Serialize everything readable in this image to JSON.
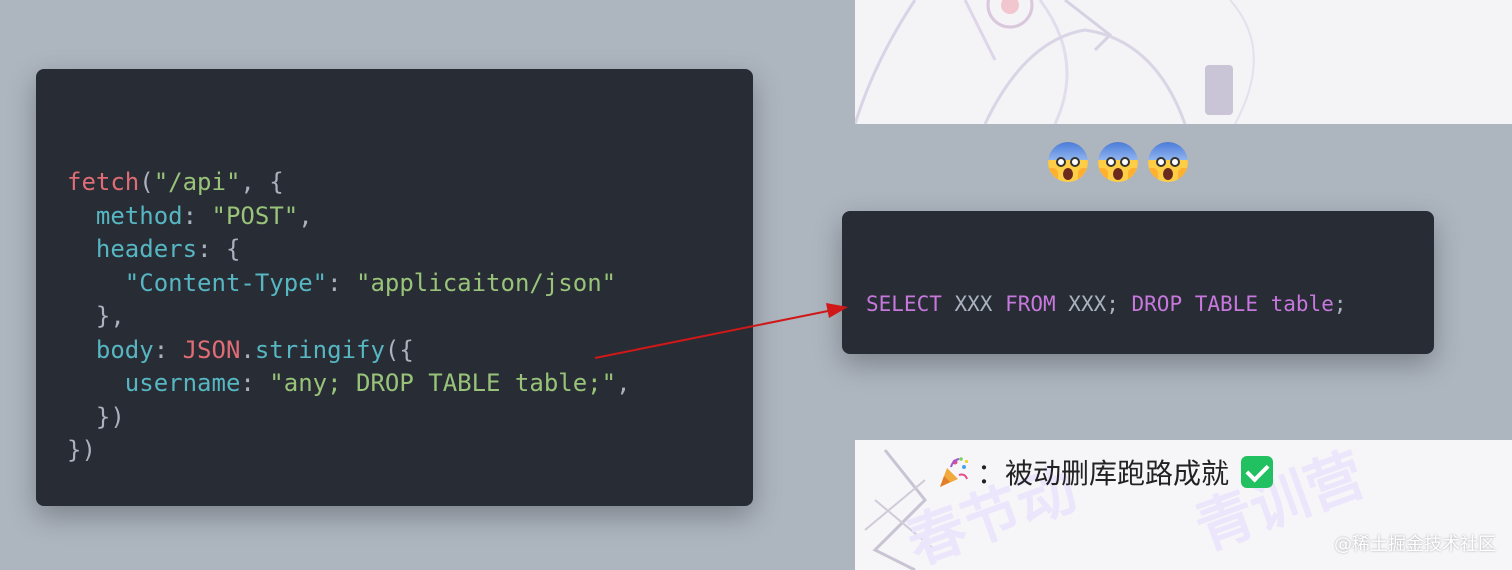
{
  "code_window": {
    "lines": {
      "l1": {
        "fn": "fetch",
        "p1": "(",
        "str": "\"/api\"",
        "p2": ", {"
      },
      "l2": {
        "indent": "  ",
        "key": "method",
        "p1": ": ",
        "str": "\"POST\"",
        "p2": ","
      },
      "l3": {
        "indent": "  ",
        "key": "headers",
        "p1": ": {"
      },
      "l4": {
        "indent": "    ",
        "str1": "\"Content-Type\"",
        "p1": ": ",
        "str2": "\"applicaiton/json\""
      },
      "l5": {
        "text": "  },"
      },
      "l6": {
        "indent": "  ",
        "key": "body",
        "p1": ": ",
        "obj": "JSON",
        "p2": ".",
        "method": "stringify",
        "p3": "({"
      },
      "l7": {
        "indent": "    ",
        "key": "username",
        "p1": ": ",
        "str": "\"any; DROP TABLE table;\"",
        "p2": ","
      },
      "l8": {
        "text": "  })"
      },
      "l9": {
        "text": "})"
      }
    }
  },
  "sql_window": {
    "kw1": "SELECT",
    "t1": " XXX ",
    "kw2": "FROM",
    "t2": " XXX; ",
    "kw3": "DROP",
    "t3": " ",
    "kw4": "TABLE",
    "t4": " ",
    "kw5": "table",
    "t5": ";"
  },
  "emojis": [
    "face-screaming-in-fear",
    "face-screaming-in-fear",
    "face-screaming-in-fear"
  ],
  "caption": {
    "icon": "party-popper",
    "text": "：被动删库跑路成就",
    "check_icon": "check-mark-button"
  },
  "watermark": "@稀土掘金技术社区",
  "colors": {
    "background": "#adb5bf",
    "window": "#282c34",
    "keyword": "#c678dd",
    "function": "#e06c75",
    "property": "#56b6c2",
    "string": "#98c379",
    "object": "#e5c07b",
    "arrow": "#d01818"
  }
}
